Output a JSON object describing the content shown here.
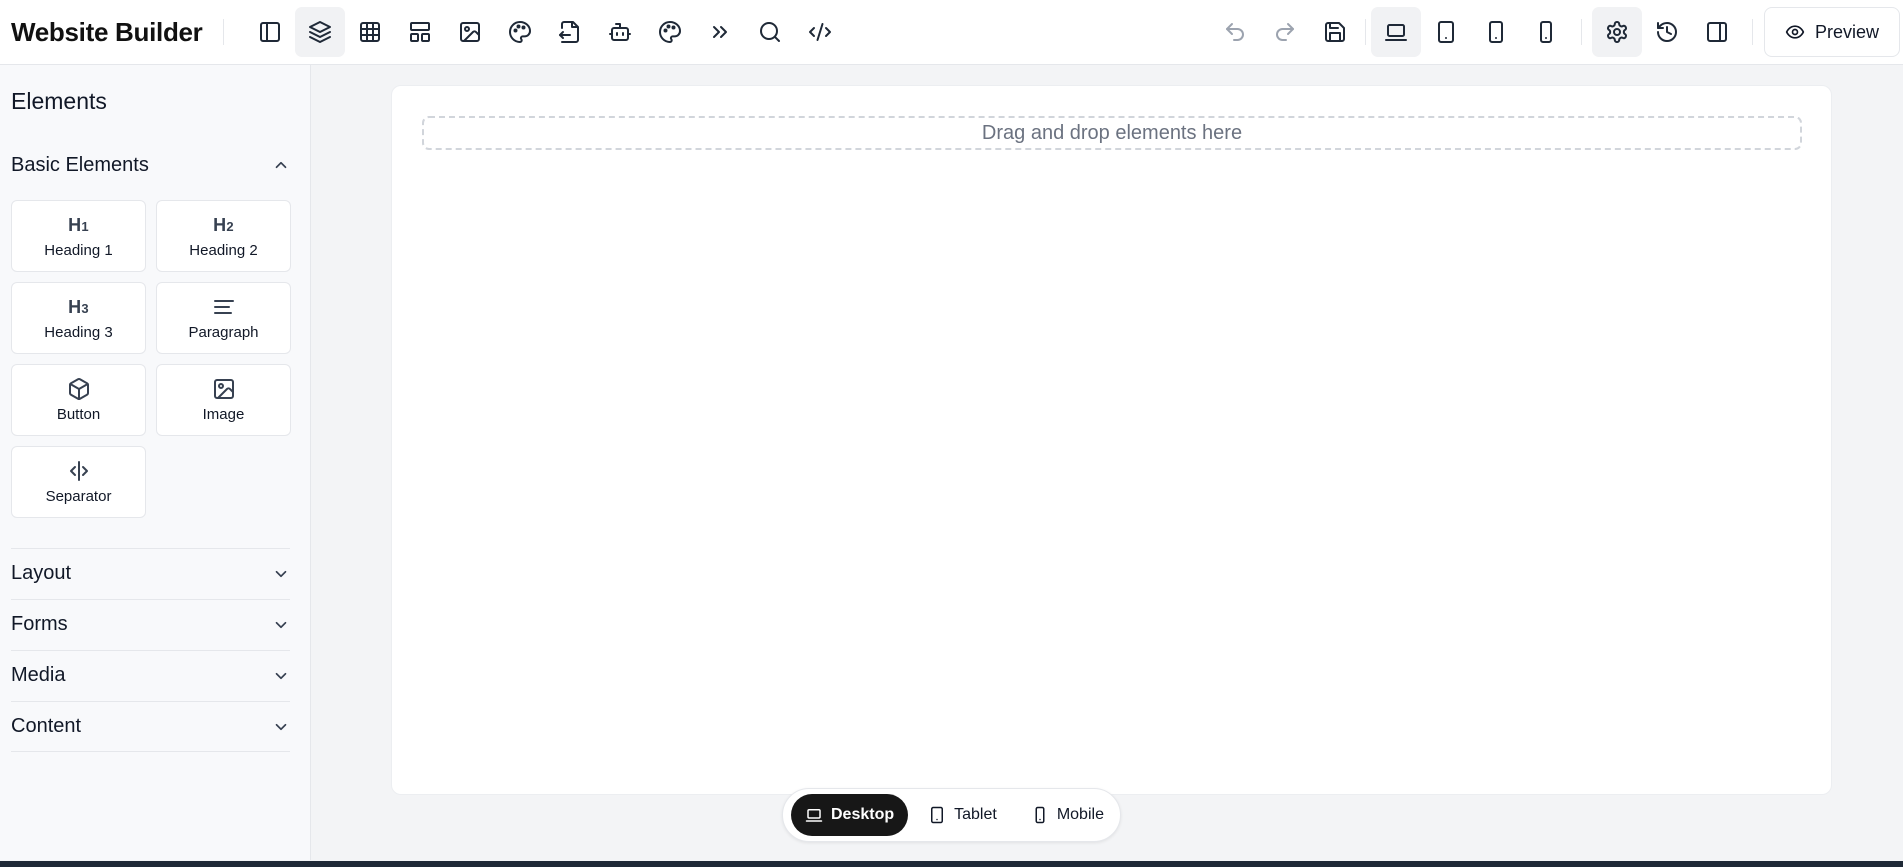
{
  "app": {
    "title": "Website Builder"
  },
  "toolbar": {
    "left_icons": [
      "sidebar-toggle-icon",
      "layers-icon",
      "table-icon",
      "layout-icon",
      "image-icon",
      "palette-icon",
      "import-icon",
      "bot-icon",
      "theme-palette-icon",
      "chevrons-right-icon",
      "search-icon",
      "code-icon"
    ],
    "right_icons": [
      "undo-icon",
      "redo-icon",
      "save-icon",
      "laptop-icon",
      "tablet-icon",
      "tablet-small-icon",
      "smartphone-icon",
      "settings-icon",
      "history-icon",
      "panel-right-icon"
    ],
    "preview_label": "Preview"
  },
  "sidebar": {
    "title": "Elements",
    "basic_section": {
      "label": "Basic Elements",
      "expanded": true,
      "items": [
        {
          "label": "Heading 1",
          "icon": "H1"
        },
        {
          "label": "Heading 2",
          "icon": "H2"
        },
        {
          "label": "Heading 3",
          "icon": "H3"
        },
        {
          "label": "Paragraph",
          "icon": "paragraph-icon"
        },
        {
          "label": "Button",
          "icon": "box-icon"
        },
        {
          "label": "Image",
          "icon": "image-icon"
        },
        {
          "label": "Separator",
          "icon": "separator-icon"
        }
      ]
    },
    "collapsed_sections": [
      {
        "label": "Layout"
      },
      {
        "label": "Forms"
      },
      {
        "label": "Media"
      },
      {
        "label": "Content"
      }
    ]
  },
  "canvas": {
    "dropzone_text": "Drag and drop elements here"
  },
  "device_switcher": {
    "selected": "Desktop",
    "options": [
      {
        "label": "Desktop",
        "icon": "laptop-icon"
      },
      {
        "label": "Tablet",
        "icon": "tablet-icon"
      },
      {
        "label": "Mobile",
        "icon": "smartphone-icon"
      }
    ]
  },
  "colors": {
    "active_device_bg": "#171717",
    "canvas_bg": "#f3f4f6",
    "border": "#e5e7eb"
  }
}
